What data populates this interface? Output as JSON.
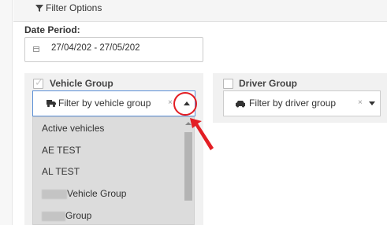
{
  "filter_header": {
    "label": "Filter Options",
    "icon": "filter-icon"
  },
  "date_period": {
    "label": "Date Period:",
    "value": "27/04/202 - 27/05/202",
    "icon": "calendar-icon"
  },
  "vehicle_group": {
    "label": "Vehicle Group",
    "checked": true,
    "placeholder": "Filter by vehicle group",
    "clear": "×",
    "icon": "truck-icon",
    "dropdown_items": [
      "Active vehicles",
      "AE TEST",
      "AL TEST",
      "Vehicle Group",
      "Group"
    ]
  },
  "driver_group": {
    "label": "Driver Group",
    "checked": false,
    "placeholder": "Filter by driver group",
    "clear": "×",
    "icon": "car-icon"
  },
  "annotation": {
    "color": "#e31e24"
  },
  "colors": {
    "select_focus_border": "#5b8fd6",
    "dropdown_bg": "#dcdcdc",
    "action_green": "#3fb868"
  }
}
